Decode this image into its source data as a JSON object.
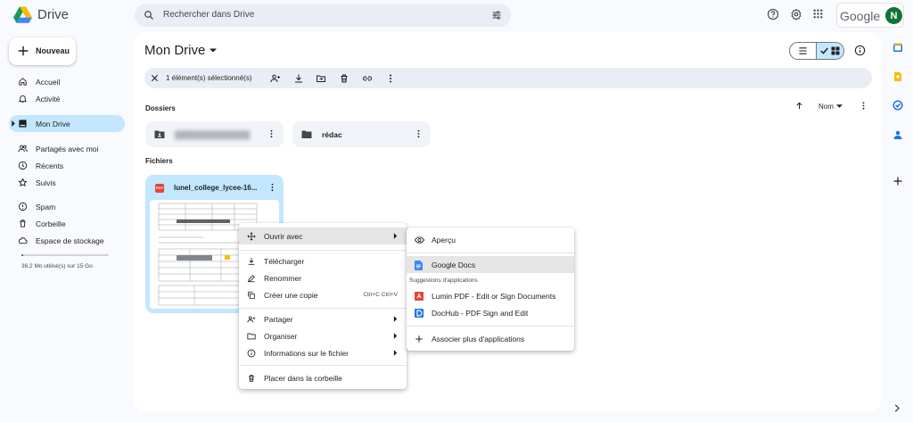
{
  "app": {
    "name": "Drive",
    "brand_word": "Google",
    "avatar_initial": "N",
    "accent": "#0b57d0",
    "selection_bg": "#c2e7ff"
  },
  "search": {
    "placeholder": "Rechercher dans Drive"
  },
  "sidebar": {
    "new_label": "Nouveau",
    "items": [
      {
        "label": "Accueil",
        "icon": "home-icon"
      },
      {
        "label": "Activité",
        "icon": "bell-icon"
      },
      {
        "label": "Mon Drive",
        "icon": "drive-icon",
        "active": true
      },
      {
        "label": "Partagés avec moi",
        "icon": "people-icon"
      },
      {
        "label": "Récents",
        "icon": "clock-icon"
      },
      {
        "label": "Suivis",
        "icon": "star-icon"
      },
      {
        "label": "Spam",
        "icon": "spam-icon"
      },
      {
        "label": "Corbeille",
        "icon": "trash-icon"
      },
      {
        "label": "Espace de stockage",
        "icon": "cloud-icon"
      }
    ],
    "storage_text": "36,2 Mo utilisé(s) sur 15 Go",
    "storage_used_fraction": 0.0024
  },
  "main": {
    "title": "Mon Drive",
    "selection_text": "1 élément(s) sélectionné(s)",
    "folders_heading": "Dossiers",
    "files_heading": "Fichiers",
    "sort_label": "Nom",
    "folders": [
      {
        "name": "██████████████",
        "icon": "shared-folder-icon",
        "blurred": true
      },
      {
        "name": "rédac",
        "icon": "folder-icon"
      }
    ],
    "files": [
      {
        "name": "lunel_college_lycee-16...",
        "type": "PDF"
      }
    ]
  },
  "context_menu": {
    "items": [
      {
        "label": "Ouvrir avec",
        "icon": "move-icon",
        "submenu": true
      },
      {
        "label": "Télécharger",
        "icon": "download-icon"
      },
      {
        "label": "Renommer",
        "icon": "edit-icon"
      },
      {
        "label": "Créer une copie",
        "icon": "copy-icon",
        "shortcut": "Ctrl+C Ctrl+V"
      },
      {
        "label": "Partager",
        "icon": "share-icon",
        "submenu": true
      },
      {
        "label": "Organiser",
        "icon": "folder-open-icon",
        "submenu": true
      },
      {
        "label": "Informations sur le fichier",
        "icon": "info-icon",
        "submenu": true
      },
      {
        "label": "Placer dans la corbeille",
        "icon": "trash-icon"
      }
    ]
  },
  "open_with_menu": {
    "items": [
      {
        "label": "Aperçu",
        "icon": "eye-icon"
      },
      {
        "label": "Google Docs",
        "icon": "google-docs-icon"
      },
      {
        "label": "Lumin PDF - Edit or Sign Documents",
        "icon": "lumin-icon"
      },
      {
        "label": "DocHub - PDF Sign and Edit",
        "icon": "dochub-icon"
      },
      {
        "label": "Associer plus d'applications",
        "icon": "plus-icon"
      }
    ],
    "suggestions_heading": "Suggestions d'applications"
  }
}
